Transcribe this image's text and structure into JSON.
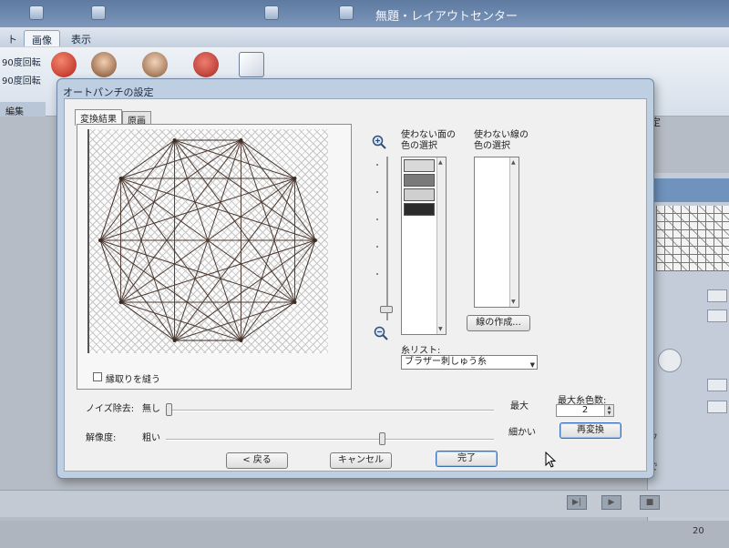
{
  "app": {
    "title": "無題・レイアウトセンター",
    "tabs": [
      {
        "label": "ト"
      },
      {
        "label": "画像"
      },
      {
        "label": "表示"
      }
    ],
    "ribbon": {
      "rotate_label_1": "90度回転",
      "rotate_label_2": "90度回転",
      "group_label": "編集"
    },
    "right_panel": {
      "label": "定",
      "text_1": "フ",
      "text_2": "で"
    },
    "status": "20"
  },
  "dialog": {
    "title": "オートパンチの設定",
    "tabs": [
      {
        "label": "変換結果"
      },
      {
        "label": "原画"
      }
    ],
    "stitch_contour_label": "縁取りを縫う",
    "unused_face_color_label_1": "使わない面の",
    "unused_face_color_label_2": "色の選択",
    "unused_line_color_label_1": "使わない線の",
    "unused_line_color_label_2": "色の選択",
    "face_swatches": [
      {
        "color": "#d9d9d9"
      },
      {
        "color": "#7a7a7a"
      },
      {
        "color": "#cfcfcf"
      },
      {
        "color": "#2b2b2b"
      }
    ],
    "create_line_button": "線の作成...",
    "thread_list_label": "糸リスト:",
    "thread_list_value": "ブラザー刺しゅう糸",
    "noise_label": "ノイズ除去:",
    "noise_min": "無し",
    "noise_max": "最大",
    "resolution_label": "解像度:",
    "resolution_min": "粗い",
    "resolution_max": "細かい",
    "max_colors_label": "最大糸色数:",
    "max_colors_value": "2",
    "reconvert_button": "再変換",
    "back_button": "< 戻る",
    "cancel_button": "キャンセル",
    "finish_button": "完了",
    "noise_level": 0.0,
    "resolution_level": 0.65
  }
}
